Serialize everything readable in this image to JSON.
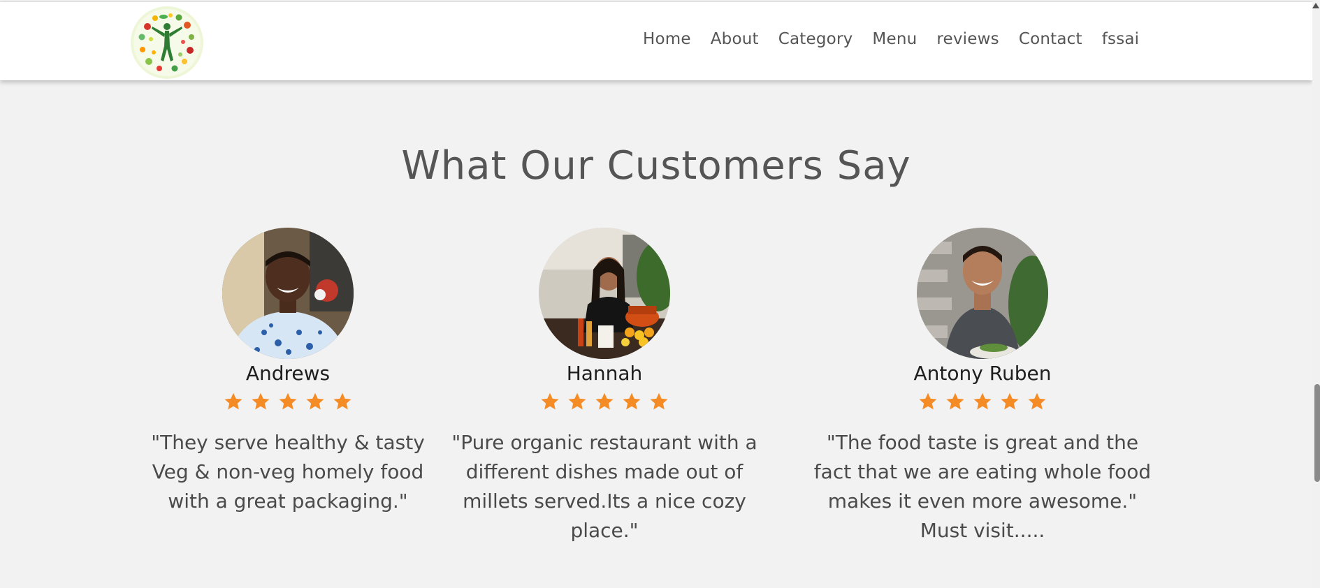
{
  "nav": {
    "logo_alt": "logo",
    "links": [
      "Home",
      "About",
      "Category",
      "Menu",
      "reviews",
      "Contact",
      "fssai"
    ]
  },
  "section": {
    "title": "What Our Customers Say"
  },
  "colors": {
    "star": "#f58b25",
    "title": "#555555",
    "background": "#f2f2f2",
    "logo_green": "#2e7d32"
  },
  "reviews": [
    {
      "name": "Andrews",
      "rating": 5,
      "text": "\"They serve healthy & tasty Veg & non-veg homely food with a great packaging.\""
    },
    {
      "name": "Hannah",
      "rating": 5,
      "text": "\"Pure organic restaurant with a different dishes made out of millets served.Its a nice cozy place.\""
    },
    {
      "name": "Antony Ruben",
      "rating": 5,
      "text": "\"The food taste is great and the fact that we are eating whole food makes it even more awesome.\" Must visit....."
    }
  ]
}
